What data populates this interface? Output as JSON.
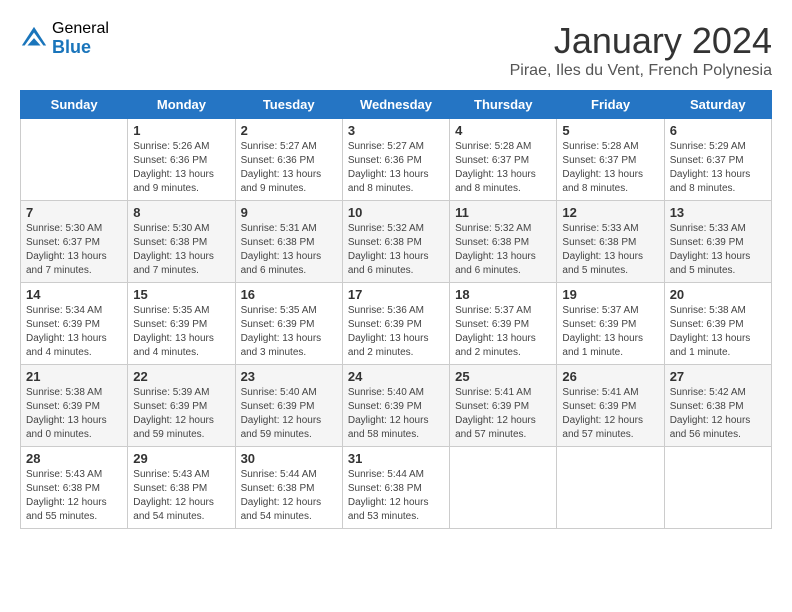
{
  "header": {
    "logo_general": "General",
    "logo_blue": "Blue",
    "title": "January 2024",
    "subtitle": "Pirae, Iles du Vent, French Polynesia"
  },
  "days_of_week": [
    "Sunday",
    "Monday",
    "Tuesday",
    "Wednesday",
    "Thursday",
    "Friday",
    "Saturday"
  ],
  "weeks": [
    [
      {
        "day": "",
        "info": ""
      },
      {
        "day": "1",
        "info": "Sunrise: 5:26 AM\nSunset: 6:36 PM\nDaylight: 13 hours\nand 9 minutes."
      },
      {
        "day": "2",
        "info": "Sunrise: 5:27 AM\nSunset: 6:36 PM\nDaylight: 13 hours\nand 9 minutes."
      },
      {
        "day": "3",
        "info": "Sunrise: 5:27 AM\nSunset: 6:36 PM\nDaylight: 13 hours\nand 8 minutes."
      },
      {
        "day": "4",
        "info": "Sunrise: 5:28 AM\nSunset: 6:37 PM\nDaylight: 13 hours\nand 8 minutes."
      },
      {
        "day": "5",
        "info": "Sunrise: 5:28 AM\nSunset: 6:37 PM\nDaylight: 13 hours\nand 8 minutes."
      },
      {
        "day": "6",
        "info": "Sunrise: 5:29 AM\nSunset: 6:37 PM\nDaylight: 13 hours\nand 8 minutes."
      }
    ],
    [
      {
        "day": "7",
        "info": "Sunrise: 5:30 AM\nSunset: 6:37 PM\nDaylight: 13 hours\nand 7 minutes."
      },
      {
        "day": "8",
        "info": "Sunrise: 5:30 AM\nSunset: 6:38 PM\nDaylight: 13 hours\nand 7 minutes."
      },
      {
        "day": "9",
        "info": "Sunrise: 5:31 AM\nSunset: 6:38 PM\nDaylight: 13 hours\nand 6 minutes."
      },
      {
        "day": "10",
        "info": "Sunrise: 5:32 AM\nSunset: 6:38 PM\nDaylight: 13 hours\nand 6 minutes."
      },
      {
        "day": "11",
        "info": "Sunrise: 5:32 AM\nSunset: 6:38 PM\nDaylight: 13 hours\nand 6 minutes."
      },
      {
        "day": "12",
        "info": "Sunrise: 5:33 AM\nSunset: 6:38 PM\nDaylight: 13 hours\nand 5 minutes."
      },
      {
        "day": "13",
        "info": "Sunrise: 5:33 AM\nSunset: 6:39 PM\nDaylight: 13 hours\nand 5 minutes."
      }
    ],
    [
      {
        "day": "14",
        "info": "Sunrise: 5:34 AM\nSunset: 6:39 PM\nDaylight: 13 hours\nand 4 minutes."
      },
      {
        "day": "15",
        "info": "Sunrise: 5:35 AM\nSunset: 6:39 PM\nDaylight: 13 hours\nand 4 minutes."
      },
      {
        "day": "16",
        "info": "Sunrise: 5:35 AM\nSunset: 6:39 PM\nDaylight: 13 hours\nand 3 minutes."
      },
      {
        "day": "17",
        "info": "Sunrise: 5:36 AM\nSunset: 6:39 PM\nDaylight: 13 hours\nand 2 minutes."
      },
      {
        "day": "18",
        "info": "Sunrise: 5:37 AM\nSunset: 6:39 PM\nDaylight: 13 hours\nand 2 minutes."
      },
      {
        "day": "19",
        "info": "Sunrise: 5:37 AM\nSunset: 6:39 PM\nDaylight: 13 hours\nand 1 minute."
      },
      {
        "day": "20",
        "info": "Sunrise: 5:38 AM\nSunset: 6:39 PM\nDaylight: 13 hours\nand 1 minute."
      }
    ],
    [
      {
        "day": "21",
        "info": "Sunrise: 5:38 AM\nSunset: 6:39 PM\nDaylight: 13 hours\nand 0 minutes."
      },
      {
        "day": "22",
        "info": "Sunrise: 5:39 AM\nSunset: 6:39 PM\nDaylight: 12 hours\nand 59 minutes."
      },
      {
        "day": "23",
        "info": "Sunrise: 5:40 AM\nSunset: 6:39 PM\nDaylight: 12 hours\nand 59 minutes."
      },
      {
        "day": "24",
        "info": "Sunrise: 5:40 AM\nSunset: 6:39 PM\nDaylight: 12 hours\nand 58 minutes."
      },
      {
        "day": "25",
        "info": "Sunrise: 5:41 AM\nSunset: 6:39 PM\nDaylight: 12 hours\nand 57 minutes."
      },
      {
        "day": "26",
        "info": "Sunrise: 5:41 AM\nSunset: 6:39 PM\nDaylight: 12 hours\nand 57 minutes."
      },
      {
        "day": "27",
        "info": "Sunrise: 5:42 AM\nSunset: 6:38 PM\nDaylight: 12 hours\nand 56 minutes."
      }
    ],
    [
      {
        "day": "28",
        "info": "Sunrise: 5:43 AM\nSunset: 6:38 PM\nDaylight: 12 hours\nand 55 minutes."
      },
      {
        "day": "29",
        "info": "Sunrise: 5:43 AM\nSunset: 6:38 PM\nDaylight: 12 hours\nand 54 minutes."
      },
      {
        "day": "30",
        "info": "Sunrise: 5:44 AM\nSunset: 6:38 PM\nDaylight: 12 hours\nand 54 minutes."
      },
      {
        "day": "31",
        "info": "Sunrise: 5:44 AM\nSunset: 6:38 PM\nDaylight: 12 hours\nand 53 minutes."
      },
      {
        "day": "",
        "info": ""
      },
      {
        "day": "",
        "info": ""
      },
      {
        "day": "",
        "info": ""
      }
    ]
  ]
}
